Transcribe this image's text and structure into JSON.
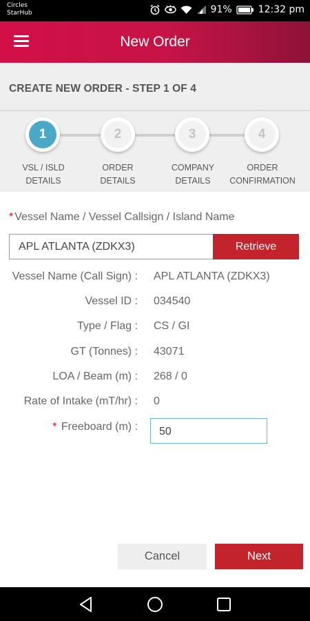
{
  "status_bar": {
    "carrier_line1": "Circles",
    "carrier_line2": "StarHub",
    "battery": "91%",
    "time": "12:32 pm",
    "icons": [
      "alarm-icon",
      "eye-icon",
      "wifi-icon",
      "signal-icon",
      "battery-icon"
    ]
  },
  "app_bar": {
    "title": "New Order",
    "menu_icon": "hamburger-menu-icon",
    "gradient": [
      "#d30f47",
      "#8e1238"
    ]
  },
  "step_header": {
    "text": "CREATE NEW ORDER - STEP 1 OF 4"
  },
  "stepper": {
    "active_step": 1,
    "active_color": "#4aa9c9",
    "steps": [
      {
        "number": "1",
        "line1": "VSL / ISLD",
        "line2": "DETAILS"
      },
      {
        "number": "2",
        "line1": "ORDER",
        "line2": "DETAILS"
      },
      {
        "number": "3",
        "line1": "COMPANY",
        "line2": "DETAILS"
      },
      {
        "number": "4",
        "line1": "ORDER",
        "line2": "CONFIRMATION"
      }
    ]
  },
  "form": {
    "required_marker": "*",
    "vessel_field_label": "Vessel Name / Vessel Callsign / Island Name",
    "vessel_input_value": "APL ATLANTA (ZDKX3)",
    "retrieve_label": "Retrieve",
    "details": [
      {
        "label": "Vessel Name (Call Sign) :",
        "value": "APL ATLANTA (ZDKX3)"
      },
      {
        "label": "Vessel ID :",
        "value": "034540"
      },
      {
        "label": "Type / Flag :",
        "value": "CS / GI"
      },
      {
        "label": "GT  (Tonnes) :",
        "value": "43071"
      },
      {
        "label": "LOA / Beam (m) :",
        "value": "268 / 0"
      },
      {
        "label": "Rate of Intake (mT/hr) :",
        "value": "0"
      }
    ],
    "freeboard_label": "Freeboard (m) :",
    "freeboard_value": "50"
  },
  "actions": {
    "cancel_label": "Cancel",
    "next_label": "Next",
    "primary_color": "#c3242c"
  },
  "nav_bar": {
    "icons": [
      "back-icon",
      "home-icon",
      "recents-icon"
    ]
  }
}
